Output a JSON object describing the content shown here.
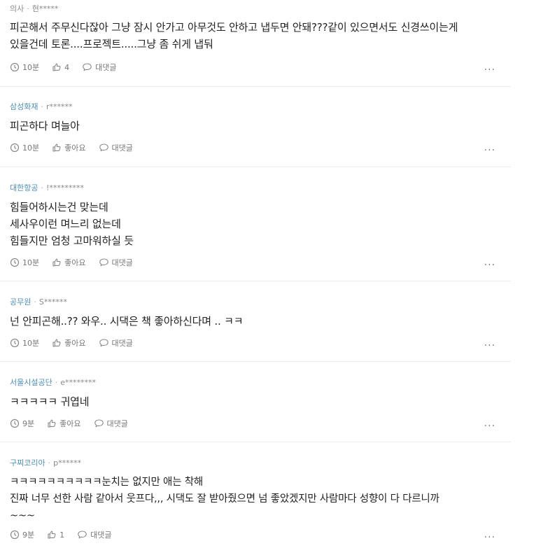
{
  "comments": [
    {
      "company": "의사",
      "user": "현*****",
      "lines": [
        "피곤해서 주무신다잖아 그냥 잠시 안가고 아무것도 안하고 냅두면 안돼???같이 있으면서도 신경쓰이는게",
        "있을건데 토론....프로젝트.....그냥 좀 쉬게 냅둬"
      ],
      "time": "10분",
      "likes": "4",
      "reply": "대댓글",
      "more": "..."
    },
    {
      "company": "삼성화재",
      "user": "r******",
      "lines": [
        "피곤하다 며늘아"
      ],
      "time": "10분",
      "likes": "좋아요",
      "reply": "대댓글",
      "more": "..."
    },
    {
      "company": "대한항공",
      "user": "!*********",
      "lines": [
        "힘들어하시는건 맞는데",
        "세사우이런 며느리 없는데",
        "힘들지만 엄청 고마워하실 듯"
      ],
      "time": "10분",
      "likes": "좋아요",
      "reply": "대댓글",
      "more": "..."
    },
    {
      "company": "공무원",
      "user": "S******",
      "lines": [
        "넌 안피곤해..?? 와우.. 시댁은 책 좋아하신다며 .. ㅋㅋ"
      ],
      "time": "10분",
      "likes": "좋아요",
      "reply": "대댓글",
      "more": "..."
    },
    {
      "company": "서울시설공단",
      "user": "e********",
      "lines": [
        "ㅋㅋㅋㅋㅋ 귀엽네"
      ],
      "time": "9분",
      "likes": "좋아요",
      "reply": "대댓글",
      "more": "..."
    },
    {
      "company": "구찌코리아",
      "user": "p******",
      "lines": [
        "ㅋㅋㅋㅋㅋㅋㅋㅋㅋㅋ눈치는 없지만 애는 착해",
        "진짜 너무 선한 사람 같아서 웃프다,,, 시댁도 잘 받아줬으면 넘 좋았겠지만 사람마다 성향이 다 다르니까",
        "~~~"
      ],
      "time": "9분",
      "likes": "1",
      "reply": "대댓글",
      "more": "..."
    }
  ],
  "icons": {
    "time": "clock-icon",
    "like": "thumbs-up-icon",
    "reply": "speech-bubble-icon",
    "more": "more-icon"
  },
  "colors": {
    "company": "#4a8fb8",
    "meta": "#8a8a8a",
    "divider": "#ececec"
  }
}
